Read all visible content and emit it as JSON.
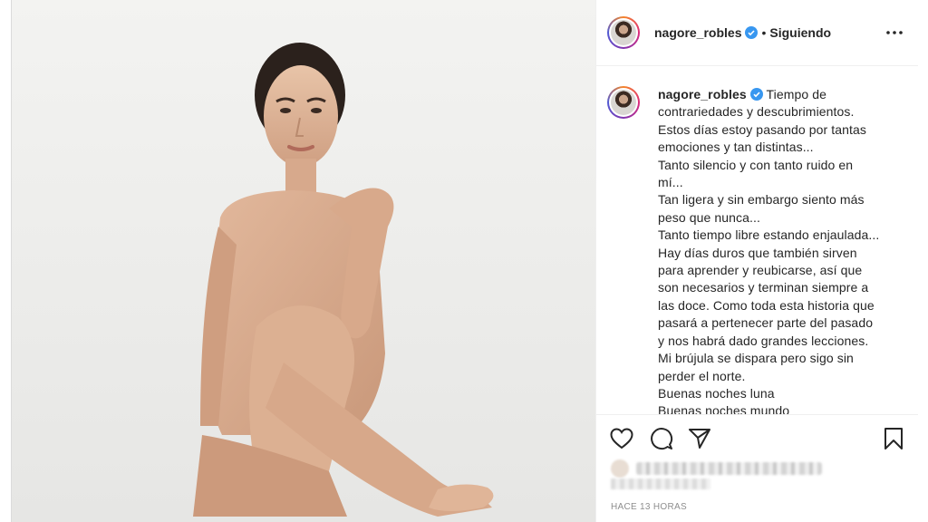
{
  "post": {
    "username": "nagore_robles",
    "separator": "•",
    "follow_label": "Siguiendo",
    "caption_lines": [
      "Tiempo de",
      "contrariedades y descubrimientos.",
      "Estos días estoy pasando por tantas",
      "emociones y tan distintas...",
      "Tanto silencio y con tanto ruido en",
      "mí...",
      "Tan ligera y sin embargo siento más",
      "peso que nunca...",
      "Tanto tiempo libre estando enjaulada...",
      "Hay días duros que también sirven",
      "para aprender y reubicarse, así que",
      "son necesarios y terminan siempre a",
      "las doce. Como toda esta historia que",
      "pasará a pertenecer parte del pasado",
      "y nos habrá dado grandes lecciones.",
      "Mi brújula se dispara pero sigo sin",
      "perder el norte.",
      "Buenas noches luna",
      "Buenas noches mundo"
    ],
    "timestamp": "HACE 13 HORAS"
  },
  "icons": {
    "verified": "verified-badge-icon",
    "more": "more-options-icon",
    "like": "heart-icon",
    "comment": "comment-icon",
    "share": "share-icon",
    "save": "bookmark-icon"
  },
  "colors": {
    "verified": "#3897f0",
    "text": "#262626",
    "muted": "#8e8e8e",
    "border": "#efefef"
  }
}
